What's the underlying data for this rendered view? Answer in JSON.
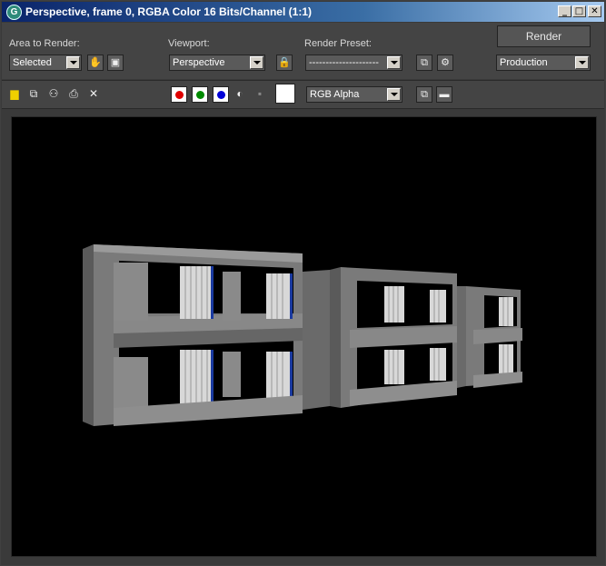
{
  "window": {
    "title": "Perspective, frame 0, RGBA Color 16 Bits/Channel (1:1)"
  },
  "titlebar": {
    "minimize": "_",
    "maximize": "□",
    "close": "✕",
    "app_icon": "G"
  },
  "area_to_render": {
    "label": "Area to Render:",
    "value": "Selected"
  },
  "viewport_select": {
    "label": "Viewport:",
    "value": "Perspective"
  },
  "render_preset": {
    "label": "Render Preset:",
    "value": "---------------------"
  },
  "render": {
    "button_label": "Render",
    "mode": "Production"
  },
  "toolbar": {
    "channel_display": "RGB Alpha"
  },
  "colors": {
    "red": "#e00000",
    "green": "#008a00",
    "blue": "#0000d8",
    "swatch": "#ffffff",
    "background": "#000000"
  },
  "icons": [
    "save-icon",
    "clone-icon",
    "copy-icon",
    "print-icon",
    "clear-icon",
    "hand-icon",
    "region-icon",
    "lock-icon",
    "preset-icon",
    "environment-icon",
    "mono-icon",
    "alpha-icon",
    "toggle-ui-icon",
    "frame-buffer-icon"
  ]
}
